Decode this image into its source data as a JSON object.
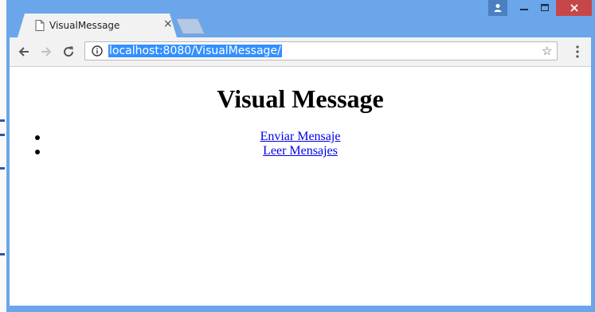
{
  "browser": {
    "tab_title": "VisualMessage",
    "tab_close": "×",
    "url": "localhost:8080/VisualMessage/",
    "window_controls": {
      "minimize": "—",
      "maximize": "☐",
      "close": "✕"
    }
  },
  "page": {
    "heading": "Visual Message",
    "links": [
      {
        "label": "Enviar Mensaje"
      },
      {
        "label": "Leer Mensajes"
      }
    ]
  },
  "colors": {
    "window_frame": "#6aa6e9",
    "close_button": "#c74748",
    "url_selection": "#3390ff",
    "link": "#0000ee"
  }
}
